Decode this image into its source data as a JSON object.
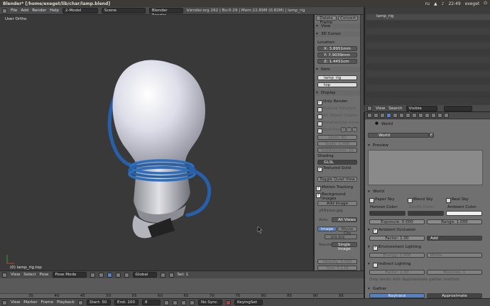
{
  "system": {
    "window_title": "Blender* [/home/exeget/lib/char/lamp.blend]",
    "time": "22:49",
    "user": "exeget",
    "lang": "ru"
  },
  "topbar": {
    "menus": [
      "File",
      "Add",
      "Render",
      "Help"
    ],
    "layout": "2-Model",
    "scene": "Scene",
    "engine": "Blender Render",
    "info": "blender.org 262 | Bo:0-29 | Mem:22.89M (0.82M) | lamp_rig"
  },
  "viewport": {
    "title": "User Ortho",
    "status": "(0) lamp_rig.top"
  },
  "npanel": {
    "delete_frame": "Delete Frame",
    "convert": "Convert",
    "view_header": "View",
    "cursor_header": "3D Cursor",
    "location_label": "Location:",
    "cursor_x": "X: 3.8951mm",
    "cursor_y": "Y: 7.9039mm",
    "cursor_z": "Z: 1.4451cm",
    "item_header": "Item",
    "item_name": "lamp_rig",
    "item_sub": "top",
    "display_header": "Display",
    "only_render": "Only Render",
    "outline_selected": "Outline Selected",
    "all_object_origins": "All Object Origins",
    "relationship_lines": "Relationship Lines",
    "grid_floor": "Grid Floor",
    "grid_axes": [
      "X",
      "Y",
      "Z"
    ],
    "lines": "Lines: 60",
    "scale": "Scale: 1.000",
    "subdivisions": "Subdivisions: 10",
    "shading_label": "Shading",
    "shading_value": "GLSL",
    "textured_solid": "Textured Solid",
    "toggle_quad": "Toggle Quad View",
    "motion_tracking": "Motion Tracking",
    "background_images": "Background Images",
    "add_image": "Add Image",
    "image_file": "y55sons.jpg",
    "axis_label": "Axis:",
    "axis_value": "All Views",
    "image_tab": "Image",
    "movie_clip_tab": "Movie Clip",
    "image_name": "jpg.jpg",
    "source_label": "Source:",
    "source_value": "Single Image",
    "opacity": "Opacity: 0.500",
    "size": "Size: 5.118"
  },
  "view_header": {
    "menus": [
      "View",
      "Select",
      "Pose"
    ],
    "mode": "Pose Mode",
    "orientation": "Global",
    "sel_label": "Sel: 1"
  },
  "timeline": {
    "ticks": [
      "35",
      "40",
      "45",
      "50",
      "55",
      "60",
      "65",
      "70",
      "75",
      "80",
      "85",
      "90",
      "95"
    ],
    "menus": [
      "View",
      "Marker",
      "Frame",
      "Playback"
    ],
    "start": "Start: 50",
    "end": "End: 100",
    "current": "8",
    "sync": "No Sync",
    "keyingset": "KeyingSet"
  },
  "outliner": {
    "item": "lamp_rig",
    "menus": [
      "View",
      "Search"
    ],
    "filter": "Visible Layers"
  },
  "props": {
    "context": "World",
    "world_name": "World",
    "world_users": "F",
    "preview": "Preview",
    "world": "World",
    "paper_sky": "Paper Sky",
    "blend_sky": "Blend Sky",
    "real_sky": "Real Sky",
    "horizon_color": "Horizon Color:",
    "zenith_color": "Zenith Color:",
    "ambient_color": "Ambient Color:",
    "exposure": "Exposure: 0.000",
    "range": "Range: 1.000",
    "ambient_occlusion": "Ambient Occlusion",
    "ao_factor": "Factor: 1.00",
    "ao_mode": "Add",
    "env_lighting": "Environment Lighting",
    "env_energy": "Energy: 1.000",
    "env_color": "White",
    "indirect_lighting": "Indirect Lighting",
    "ind_factor": "Factor: 1.00",
    "ind_bounces": "Bounces: 1",
    "ind_note": "Only works with Approximate gather method",
    "gather": "Gather",
    "raytrace": "Raytrace",
    "approximate": "Approximate"
  },
  "colors": {
    "accent": "#5680c2",
    "viewport_bg": "#393939",
    "panel_bg": "#707070",
    "horizon": "#3a3a3a",
    "ambient": "#efefef"
  }
}
